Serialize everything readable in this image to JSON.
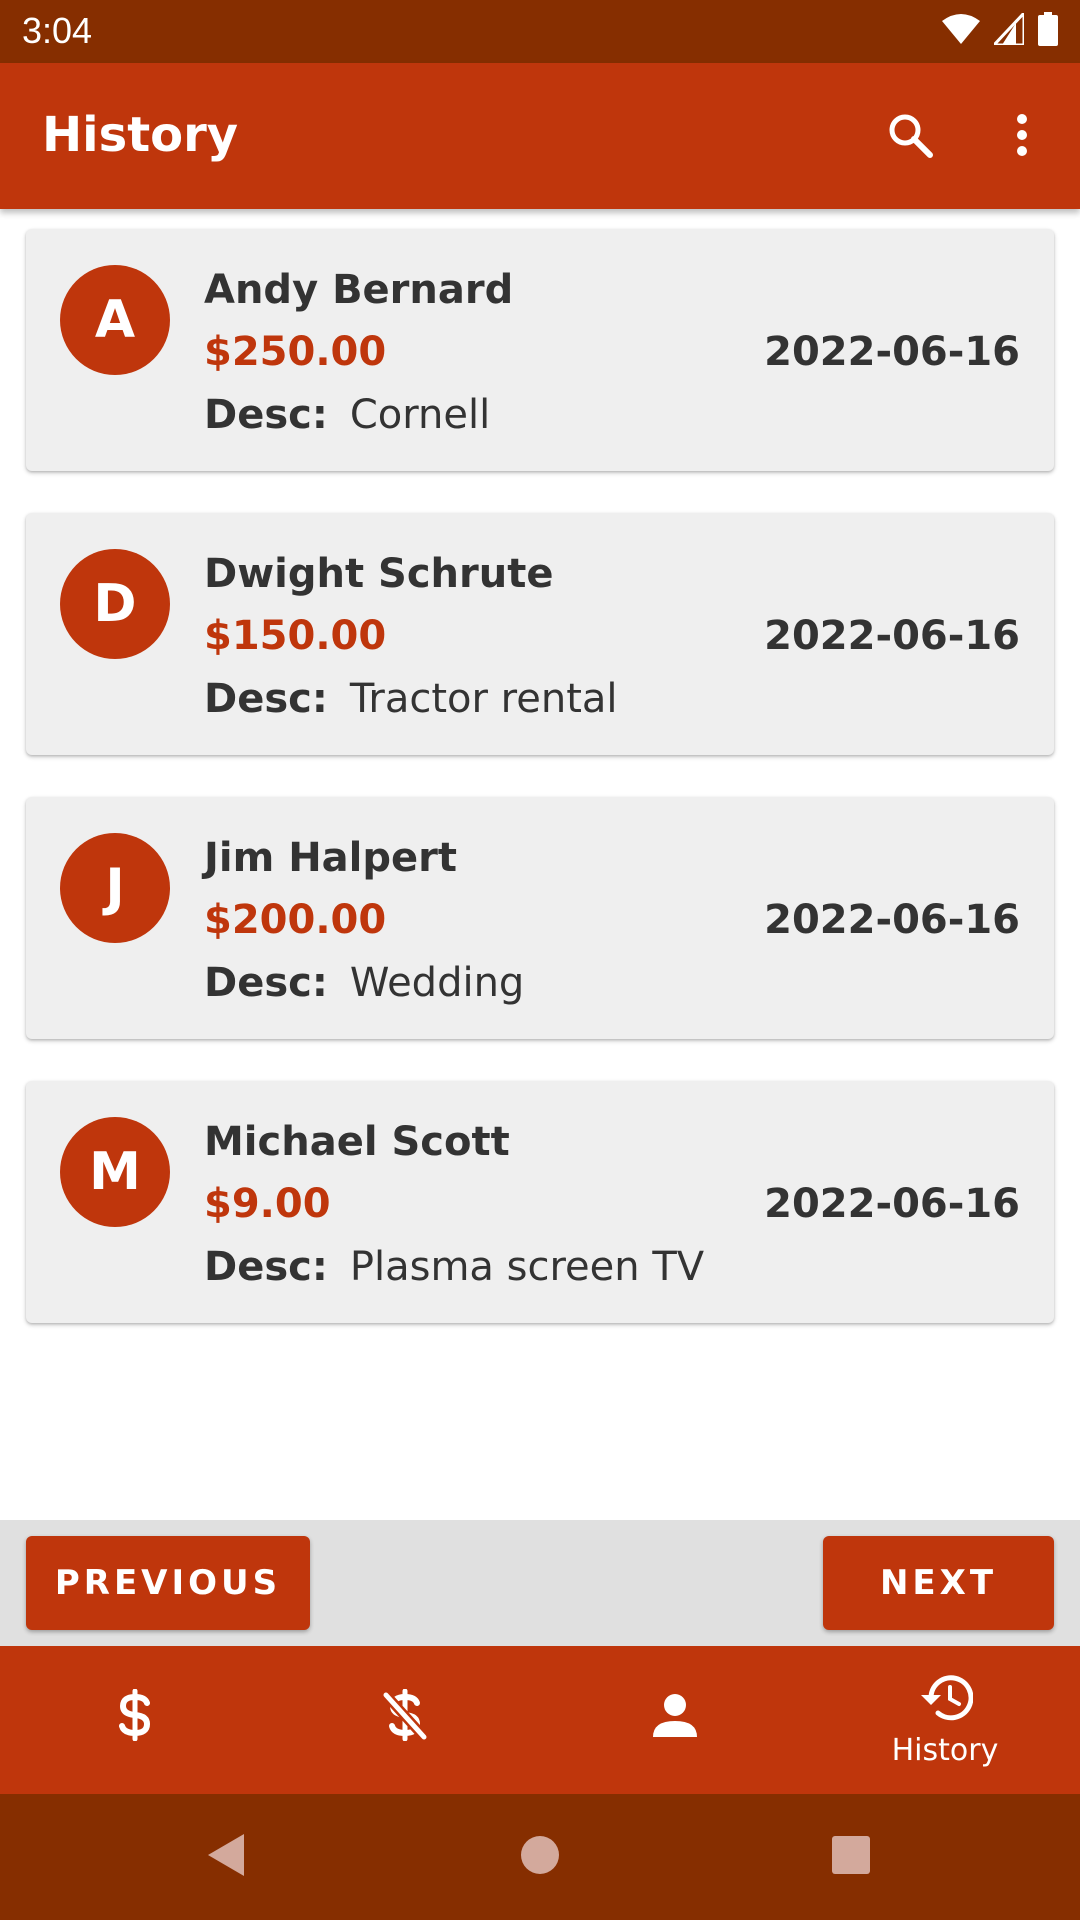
{
  "status_bar": {
    "time": "3:04"
  },
  "app_bar": {
    "title": "History"
  },
  "transactions": [
    {
      "initial": "A",
      "name": "Andy Bernard",
      "amount": "$250.00",
      "date": "2022-06-16",
      "desc_label": "Desc:",
      "desc": "Cornell"
    },
    {
      "initial": "D",
      "name": "Dwight Schrute",
      "amount": "$150.00",
      "date": "2022-06-16",
      "desc_label": "Desc:",
      "desc": "Tractor rental"
    },
    {
      "initial": "J",
      "name": "Jim Halpert",
      "amount": "$200.00",
      "date": "2022-06-16",
      "desc_label": "Desc:",
      "desc": "Wedding"
    },
    {
      "initial": "M",
      "name": "Michael Scott",
      "amount": "$9.00",
      "date": "2022-06-16",
      "desc_label": "Desc:",
      "desc": "Plasma screen TV"
    }
  ],
  "pager": {
    "previous_label": "PREVIOUS",
    "next_label": "NEXT"
  },
  "bottom_nav": {
    "items": [
      {
        "icon": "dollar-icon",
        "label": ""
      },
      {
        "icon": "money-off-icon",
        "label": ""
      },
      {
        "icon": "person-icon",
        "label": ""
      },
      {
        "icon": "history-icon",
        "label": "History",
        "selected": true
      }
    ]
  },
  "colors": {
    "primary": "#bf360c",
    "primary_dark": "#862e00",
    "card": "#efefef",
    "text": "#333333"
  }
}
